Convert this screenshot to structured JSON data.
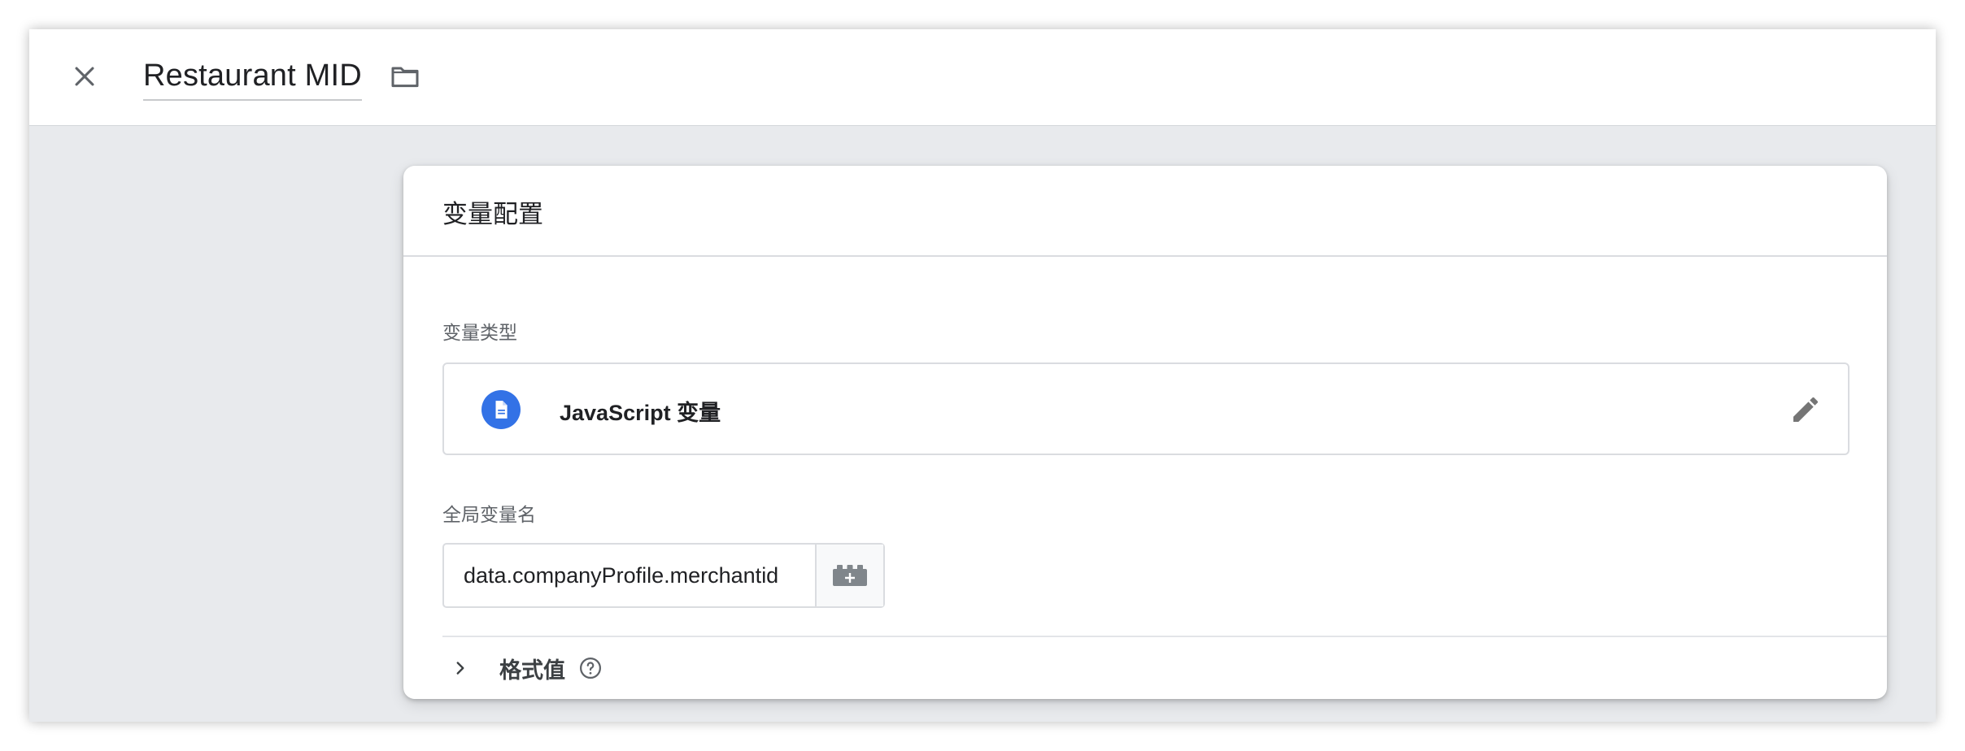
{
  "header": {
    "title": "Restaurant MID"
  },
  "card": {
    "title": "变量配置",
    "variable_type": {
      "label": "变量类型",
      "name": "JavaScript 变量"
    },
    "global_var": {
      "label": "全局变量名",
      "value": "data.companyProfile.merchantid"
    },
    "format_value": {
      "label": "格式值"
    }
  },
  "icons": {
    "close": "close-icon",
    "folder": "folder-icon",
    "type": "document-icon",
    "edit": "pencil-icon",
    "variable": "lego-brick-icon",
    "expand": "chevron-right-icon",
    "help": "help-circle-icon"
  },
  "colors": {
    "accent": "#3372e6",
    "background": "#e8eaed",
    "card": "#ffffff",
    "text": "#202124",
    "secondary_text": "#5f6368"
  }
}
